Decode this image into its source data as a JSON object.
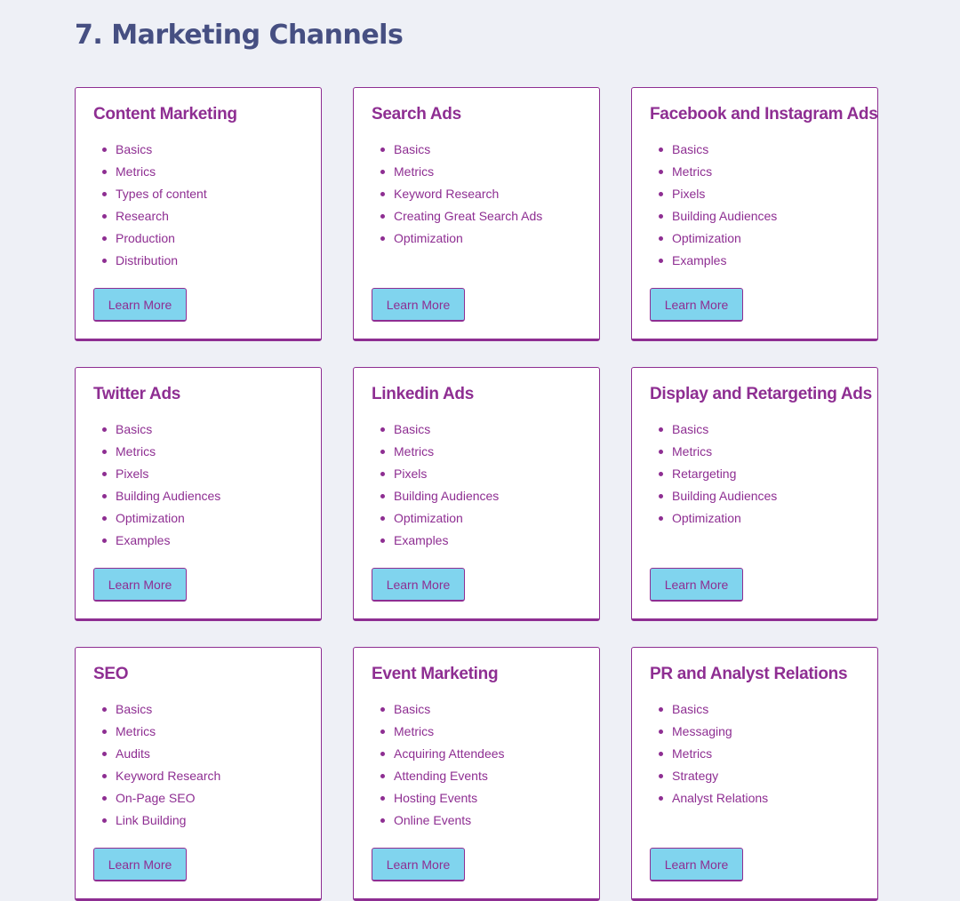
{
  "page_title": "7. Marketing Channels",
  "colors": {
    "background": "#eef0f6",
    "title": "#464f82",
    "accent": "#8e2e92",
    "button": "#80d4ee",
    "card": "#ffffff"
  },
  "cards": [
    {
      "title": "Content Marketing",
      "items": [
        "Basics",
        "Metrics",
        "Types of content",
        "Research",
        "Production",
        "Distribution"
      ],
      "button": "Learn More"
    },
    {
      "title": "Search Ads",
      "items": [
        "Basics",
        "Metrics",
        "Keyword Research",
        "Creating Great Search Ads",
        "Optimization"
      ],
      "button": "Learn More"
    },
    {
      "title": "Facebook and Instagram Ads",
      "items": [
        "Basics",
        "Metrics",
        "Pixels",
        "Building Audiences",
        "Optimization",
        "Examples"
      ],
      "button": "Learn More"
    },
    {
      "title": "Twitter Ads",
      "items": [
        "Basics",
        "Metrics",
        "Pixels",
        "Building Audiences",
        "Optimization",
        "Examples"
      ],
      "button": "Learn More"
    },
    {
      "title": "Linkedin Ads",
      "items": [
        "Basics",
        "Metrics",
        "Pixels",
        "Building Audiences",
        "Optimization",
        "Examples"
      ],
      "button": "Learn More"
    },
    {
      "title": "Display and Retargeting Ads",
      "items": [
        "Basics",
        "Metrics",
        "Retargeting",
        "Building Audiences",
        "Optimization"
      ],
      "button": "Learn More"
    },
    {
      "title": "SEO",
      "items": [
        "Basics",
        "Metrics",
        "Audits",
        "Keyword Research",
        "On-Page SEO",
        "Link Building"
      ],
      "button": "Learn More"
    },
    {
      "title": "Event Marketing",
      "items": [
        "Basics",
        "Metrics",
        "Acquiring Attendees",
        "Attending Events",
        "Hosting Events",
        "Online Events"
      ],
      "button": "Learn More"
    },
    {
      "title": "PR and Analyst Relations",
      "items": [
        "Basics",
        "Messaging",
        "Metrics",
        "Strategy",
        "Analyst Relations"
      ],
      "button": "Learn More"
    }
  ]
}
